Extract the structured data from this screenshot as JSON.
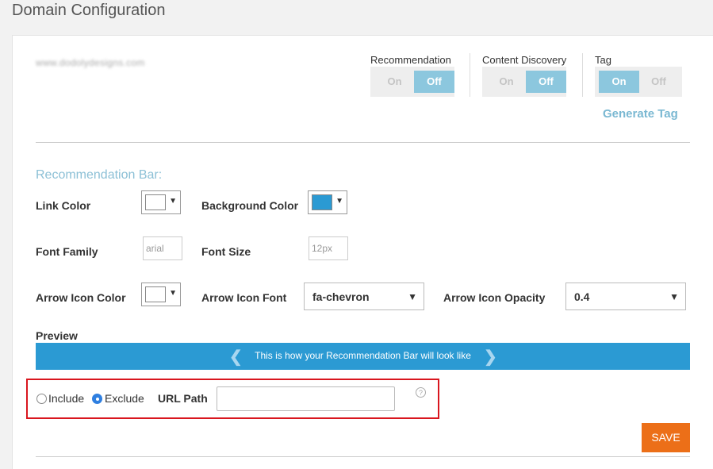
{
  "page": {
    "title": "Domain Configuration"
  },
  "domain": {
    "name": "www.dodolydesigns.com"
  },
  "toggles": [
    {
      "title": "Recommendation",
      "on": "On",
      "off": "Off",
      "state": "off"
    },
    {
      "title": "Content Discovery",
      "on": "On",
      "off": "Off",
      "state": "off"
    },
    {
      "title": "Tag",
      "on": "On",
      "off": "Off",
      "state": "on"
    }
  ],
  "generate_tag": "Generate Tag",
  "bar": {
    "section_title": "Recommendation Bar:",
    "link_color_label": "Link Color",
    "link_color": "#ffffff",
    "background_color_label": "Background Color",
    "background_color": "#2b9ad3",
    "font_family_label": "Font Family",
    "font_family_value": "arial",
    "font_size_label": "Font Size",
    "font_size_value": "12px",
    "arrow_icon_color_label": "Arrow Icon Color",
    "arrow_icon_color": "#ffffff",
    "arrow_icon_font_label": "Arrow Icon Font",
    "arrow_icon_font_value": "fa-chevron",
    "arrow_icon_opacity_label": "Arrow Icon Opacity",
    "arrow_icon_opacity_value": "0.4",
    "caret": "▼"
  },
  "preview": {
    "label": "Preview",
    "text": "This is how your Recommendation Bar will look like",
    "left_arrow": "❮",
    "right_arrow": "❯"
  },
  "filter": {
    "include_label": "Include",
    "exclude_label": "Exclude",
    "selected": "exclude",
    "url_path_label": "URL Path",
    "url_path_value": "",
    "help": "?"
  },
  "save_label": "SAVE"
}
